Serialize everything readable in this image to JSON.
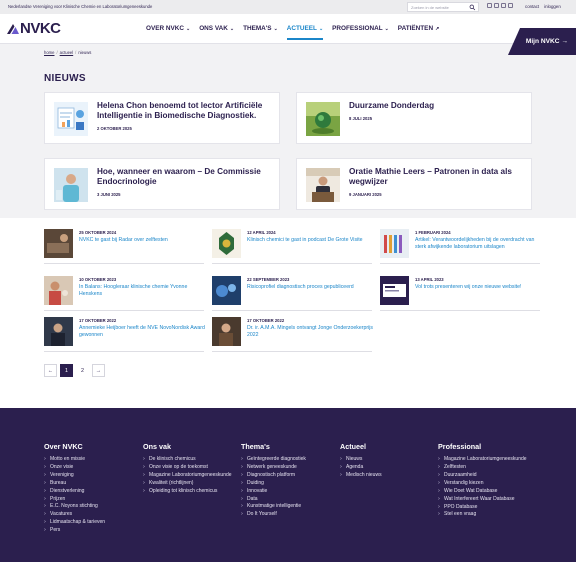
{
  "topbar": {
    "org": "Nederlandse Vereniging voor Klinische Chemie en Laboratoriumgeneeskunde",
    "search_placeholder": "Zoeken in de website",
    "links": [
      "contact",
      "inloggen"
    ]
  },
  "header": {
    "logo": "NVKC",
    "nav": [
      {
        "label": "OVER NVKC",
        "chevron": true
      },
      {
        "label": "ONS VAK",
        "chevron": true
      },
      {
        "label": "THEMA'S",
        "chevron": true
      },
      {
        "label": "ACTUEEL",
        "chevron": true,
        "active": true
      },
      {
        "label": "PROFESSIONAL",
        "chevron": true
      },
      {
        "label": "PATIËNTEN",
        "external": true
      }
    ],
    "cta": "Mijn NVKC →"
  },
  "breadcrumb": [
    "home",
    "actueel",
    "nieuws"
  ],
  "page_title": "NIEUWS",
  "featured": [
    {
      "title": "Helena Chon benoemd tot lector Artificiële Intelligentie in Biomedische Diagnostiek.",
      "date": "2 OKTOBER 2025",
      "icon": "lab-chart-illustration"
    },
    {
      "title": "Duurzame Donderdag",
      "date": "8 JULI 2025",
      "icon": "green-globe-photo"
    },
    {
      "title": "Hoe, wanneer en waarom – De Commissie Endocrinologie",
      "date": "3 JUNI 2025",
      "icon": "lab-worker-photo"
    },
    {
      "title": "Oratie Mathie Leers – Patronen in data als wegwijzer",
      "date": "9 JANUARI 2025",
      "icon": "speaker-photo"
    }
  ],
  "news": [
    {
      "date": "25 OKTOBER 2024",
      "title": "NVKC te gast bij Radar over zelftesten"
    },
    {
      "date": "12 APRIL 2024",
      "title": "Klinisch chemici te gast in podcast De Grote Visite"
    },
    {
      "date": "1 FEBRUARI 2024",
      "title": "Artikel: Verantwoordelijkheden bij de overdracht van sterk afwijkende laboratorium uitslagen"
    },
    {
      "date": "10 OKTOBER 2023",
      "title": "In Balans: Hoogleraar klinische chemie Yvonne Henskens"
    },
    {
      "date": "22 SEPTEMBER 2023",
      "title": "Risicoprofiel diagnostisch proces gepubliceerd"
    },
    {
      "date": "13 APRIL 2023",
      "title": "Vol trots presenteren wij onze nieuwe website!"
    },
    {
      "date": "17 OKTOBER 2022",
      "title": "Annemieke Heijboer heeft de NVE NovoNordisk Award gewonnen"
    },
    {
      "date": "17 OKTOBER 2022",
      "title": "Dr. ir. A.M.A. Mingels ontvangt Jonge Onderzoekerprijs 2022"
    }
  ],
  "pager": [
    "←",
    "1",
    "2",
    "→"
  ],
  "footer": [
    {
      "heading": "Over NVKC",
      "items": [
        "Motto en missie",
        "Onze visie",
        "Vereniging",
        "Bureau",
        "Dienstverlening",
        "Prijzen",
        "E.C. Noyons stichting",
        "Vacatures",
        "Lidmaatschap & tarieven",
        "Pers"
      ]
    },
    {
      "heading": "Ons vak",
      "items": [
        "De klinisch chemicus",
        "Onze visie op de toekomst",
        "Magazine Laboratoriumgeneeskunde",
        "Kwaliteit (richtlijnen)",
        "Opleiding tot klinisch chemicus"
      ]
    },
    {
      "heading": "Thema's",
      "items": [
        "Geïntegreerde diagnostiek",
        "Netwerk geneeskunde",
        "Diagnostisch platform",
        "Duiding",
        "Innovatie",
        "Data",
        "Kunstmatige intelligentie",
        "Do It Yourself"
      ]
    },
    {
      "heading": "Actueel",
      "items": [
        "Nieuws",
        "Agenda",
        "Medisch nieuws"
      ]
    },
    {
      "heading": "Professional",
      "items": [
        "Magazine Laboratoriumgeneeskunde",
        "Zelftesten",
        "Duurzaamheid",
        "Verstandig kiezen",
        "Wie Doet Wat Database",
        "Wat Interfereert Waar Database",
        "PPO Database",
        "Stel een vraag"
      ]
    }
  ],
  "colors": {
    "brand": "#2b1f4e",
    "link": "#1b86c9",
    "bg": "#f2f2f4"
  }
}
